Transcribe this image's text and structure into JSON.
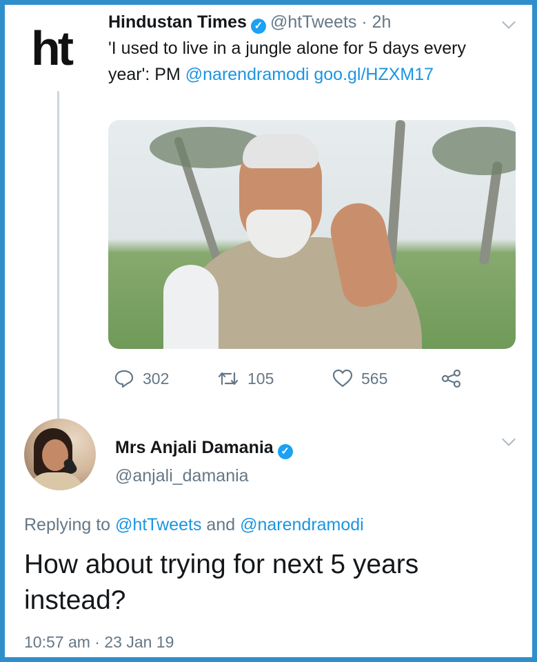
{
  "original_tweet": {
    "logo_text": "ht",
    "display_name": "Hindustan Times",
    "handle": "@htTweets",
    "separator": "·",
    "age": "2h",
    "text_plain": "'I used to live in a jungle alone for 5 days every year': PM",
    "mention": "@narendramodi",
    "link": "goo.gl/HZXM17",
    "stats": {
      "replies": "302",
      "retweets": "105",
      "likes": "565"
    },
    "icons": {
      "verified": "verified-badge-icon",
      "menu": "chevron-down-icon",
      "reply": "reply-bubble-icon",
      "retweet": "retweet-icon",
      "like": "heart-icon",
      "share": "share-icon"
    }
  },
  "reply_tweet": {
    "display_name": "Mrs Anjali Damania",
    "handle": "@anjali_damania",
    "replying_prefix": "Replying to",
    "replying_to_1": "@htTweets",
    "replying_and": "and",
    "replying_to_2": "@narendramodi",
    "text": "How about trying for next 5 years instead?",
    "time": "10:57 am",
    "separator": "·",
    "date": "23 Jan 19"
  },
  "colors": {
    "frame": "#2f8fcb",
    "link": "#1b95e0",
    "verified": "#1da1f2",
    "muted": "#657786"
  }
}
